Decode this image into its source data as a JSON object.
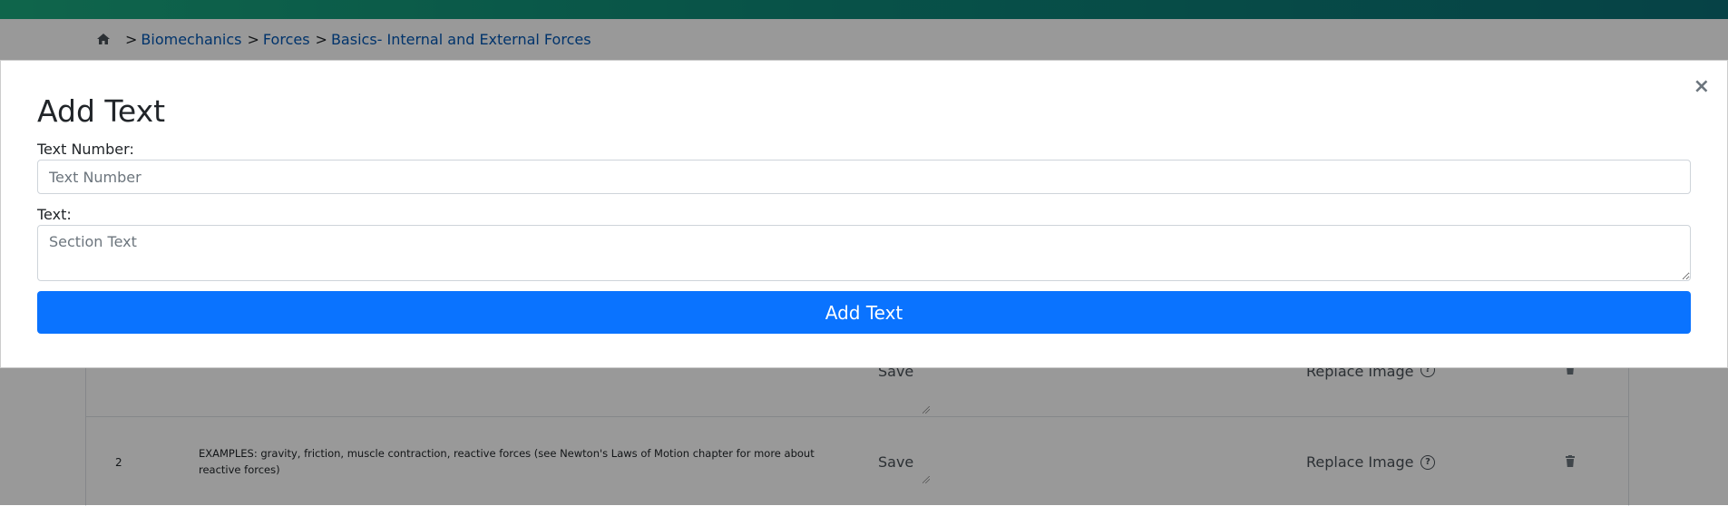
{
  "breadcrumb": {
    "home_icon": "home-icon",
    "separator": ">",
    "items": [
      "Biomechanics",
      "Forces",
      "Basics- Internal and External Forces"
    ]
  },
  "table": {
    "rows": [
      {
        "save_label": "Save",
        "replace_label": "Replace Image"
      },
      {
        "number": "2",
        "text": "EXAMPLES: gravity, friction, muscle contraction, reactive forces (see Newton's Laws of Motion chapter for more about reactive forces)",
        "save_label": "Save",
        "replace_label": "Replace Image"
      }
    ]
  },
  "modal": {
    "title": "Add Text",
    "close_label": "×",
    "text_number_label": "Text Number:",
    "text_number_placeholder": "Text Number",
    "text_label": "Text:",
    "text_placeholder": "Section Text",
    "submit_label": "Add Text"
  },
  "colors": {
    "primary": "#0a73ff",
    "link": "#0056b3",
    "header_gradient_start": "#1aa97e",
    "header_gradient_end": "#0a6f76"
  }
}
